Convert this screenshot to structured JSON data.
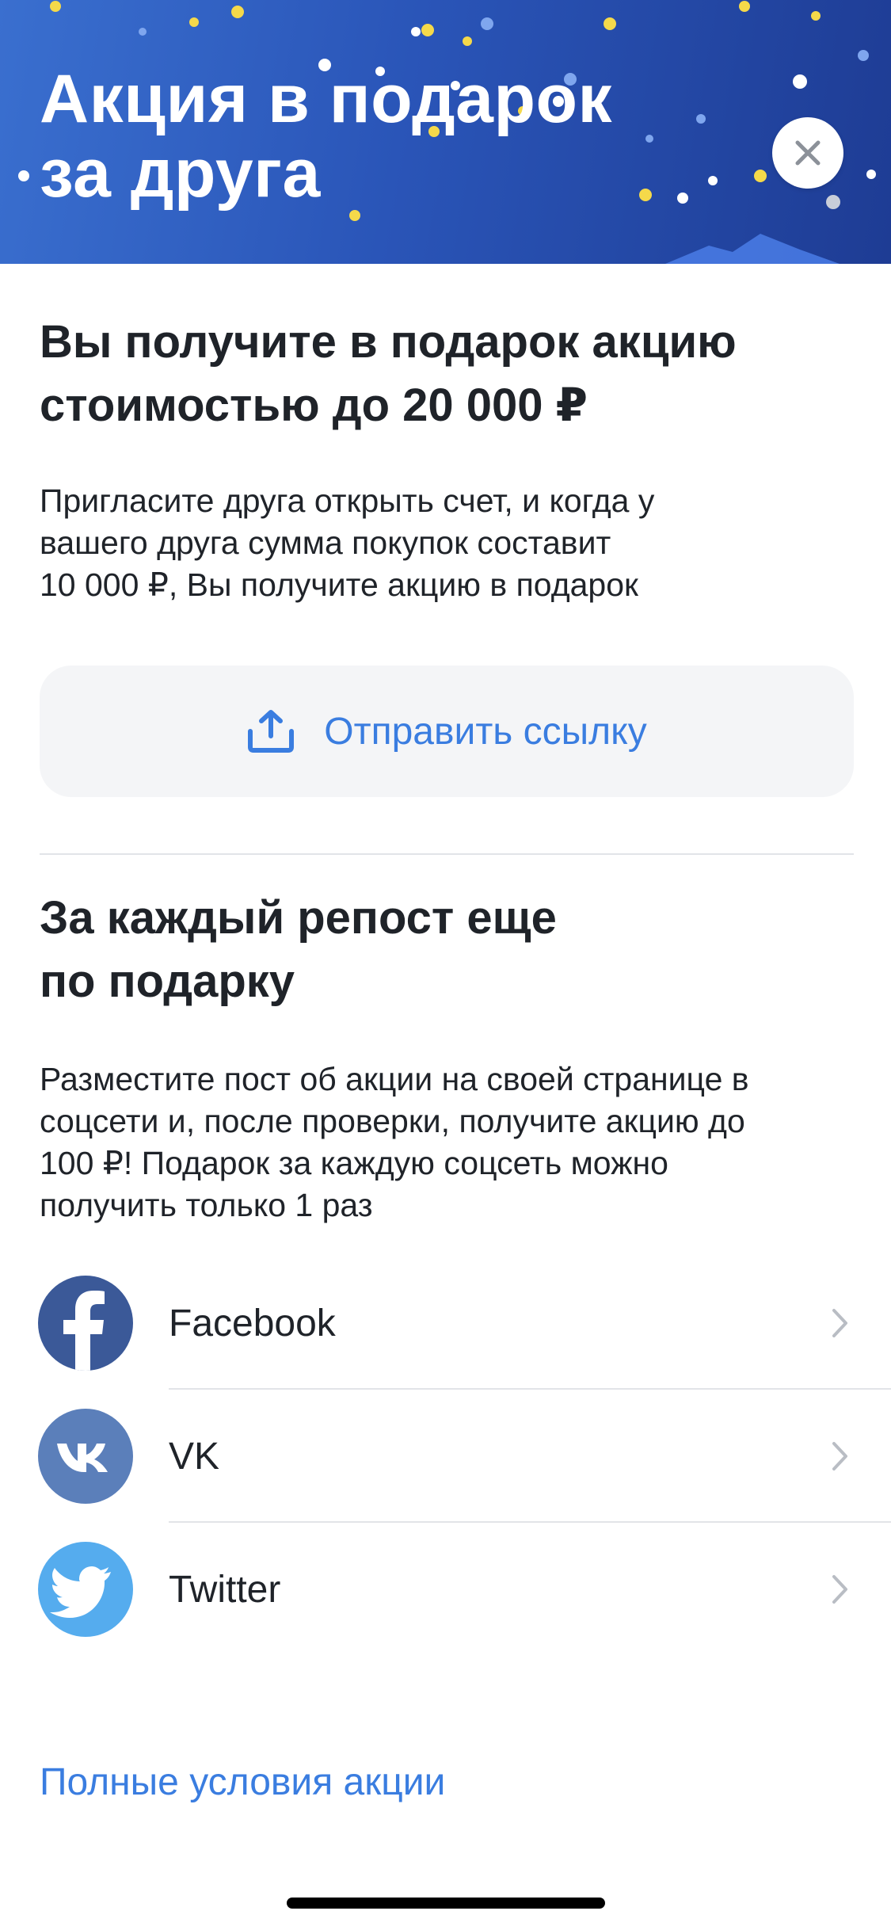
{
  "header": {
    "title_line1": "Акция в подарок",
    "title_line2": "за друга",
    "close_icon": "close-icon",
    "background_color": "#2a55b8"
  },
  "gift": {
    "title_line1": "Вы получите в подарок акцию",
    "title_line2": "стоимостью до 20 000 ₽",
    "description_line1": "Пригласите друга открыть счет, и когда у",
    "description_line2": "вашего друга сумма покупок составит",
    "description_line3": "10 000 ₽, Вы получите акцию в подарок",
    "send_button_label": "Отправить ссылку",
    "send_icon": "share-upload-icon"
  },
  "repost": {
    "title_line1": "За каждый репост еще",
    "title_line2": "по подарку",
    "description_line1": "Разместите пост об акции на своей странице в",
    "description_line2": "соцсети и, после проверки, получите акцию до",
    "description_line3": "100 ₽! Подарок за каждую соцсеть можно",
    "description_line4": "получить только 1 раз"
  },
  "social": [
    {
      "label": "Facebook",
      "icon": "facebook-icon",
      "color": "#3b5998"
    },
    {
      "label": "VK",
      "icon": "vk-icon",
      "color": "#5b7fba"
    },
    {
      "label": "Twitter",
      "icon": "twitter-icon",
      "color": "#55acee"
    }
  ],
  "terms_link": "Полные условия акции",
  "colors": {
    "accent": "#3a7de0",
    "text": "#1f2329"
  }
}
